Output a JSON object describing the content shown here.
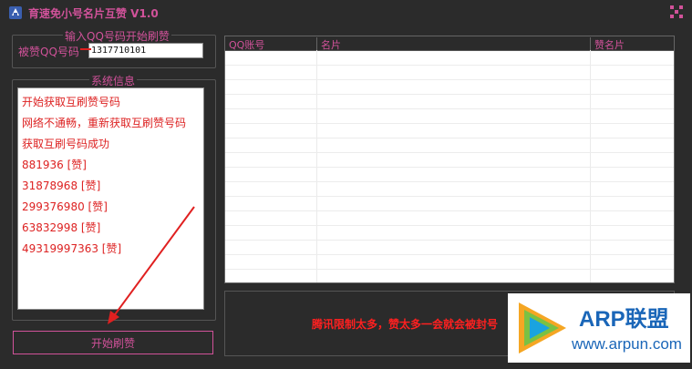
{
  "window": {
    "title": "育速免小号名片互赞 V1.0",
    "accent": "#d1529a"
  },
  "input_group": {
    "legend": "输入QQ号码开始刷赞",
    "label": "被赞QQ号码",
    "value": "1317710101"
  },
  "system_group": {
    "legend": "系统信息",
    "log": [
      "开始获取互刷赞号码",
      "网络不通畅，重新获取互刷赞号码",
      "获取互刷号码成功",
      "881936 [赞]",
      "31878968 [赞]",
      "299376980 [赞]",
      "63832998 [赞]",
      "49319997363 [赞]"
    ]
  },
  "start_button": {
    "label": "开始刷赞"
  },
  "table": {
    "columns": [
      "QQ账号",
      "名片",
      "赞名片"
    ],
    "rows": []
  },
  "notice": "腾讯限制太多，赞太多一会就会被封号",
  "watermark": {
    "brand": "ARP联盟",
    "url": "www.arpun.com"
  },
  "icons": {
    "app": "app-icon",
    "close": "close-icon",
    "watermark_logo": "play-logo-icon"
  }
}
